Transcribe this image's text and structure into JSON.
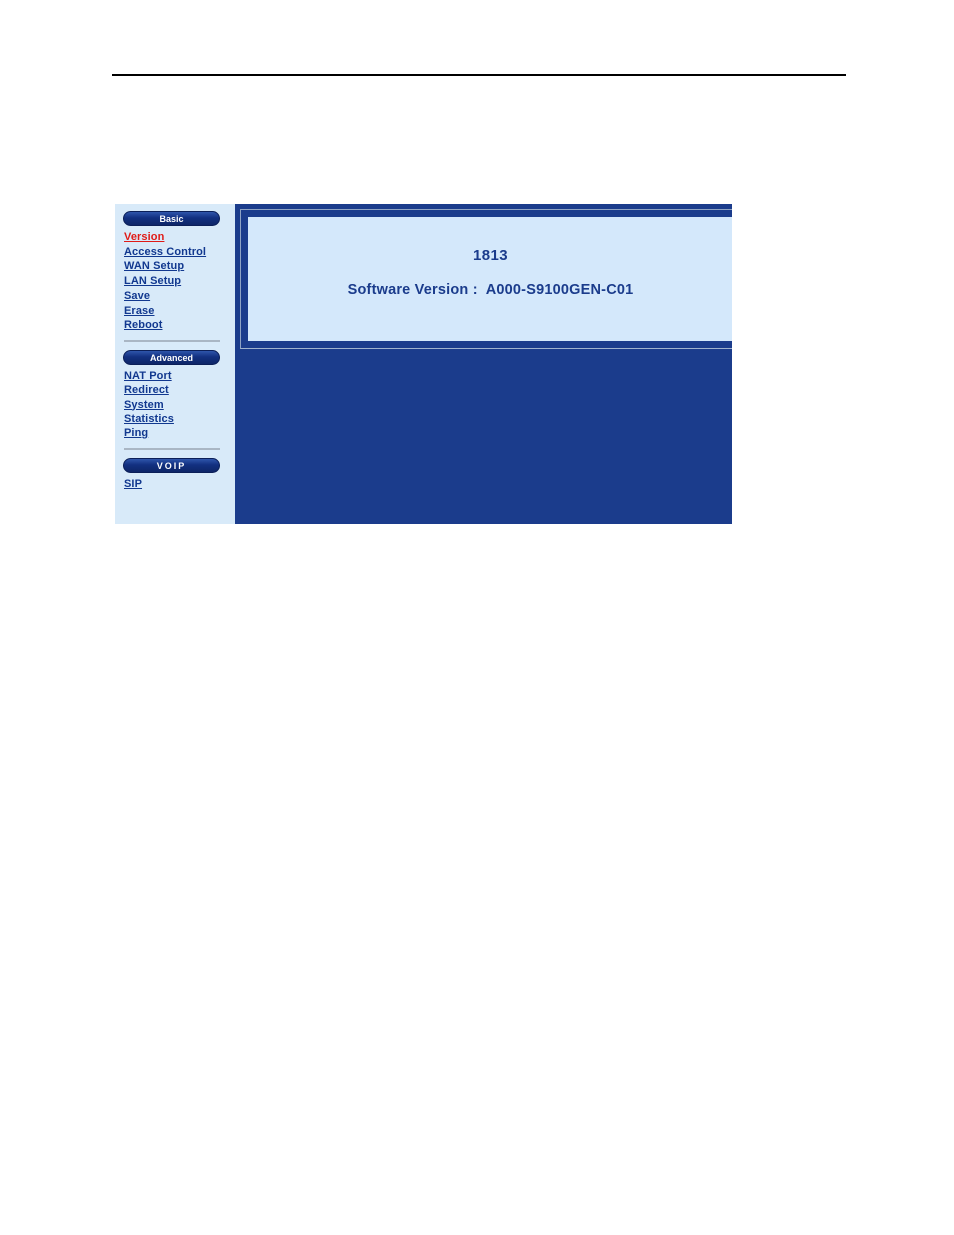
{
  "page": {
    "header_rule": "horizontal-rule",
    "background_color": "#ffffff"
  },
  "router_ui": {
    "sidebar": {
      "background_color": "#d8eaf9",
      "sections": [
        {
          "button_label": "Basic",
          "items": [
            {
              "label": "Version",
              "state": "active",
              "color": "#e01b17"
            },
            {
              "label": "Access Control",
              "state": "normal",
              "color": "#11388f"
            },
            {
              "label": "WAN Setup",
              "state": "normal",
              "color": "#11388f"
            },
            {
              "label": "LAN Setup",
              "state": "normal",
              "color": "#11388f"
            },
            {
              "label": "Save",
              "state": "normal",
              "color": "#11388f"
            },
            {
              "label": "Erase",
              "state": "normal",
              "color": "#11388f"
            },
            {
              "label": "Reboot",
              "state": "normal",
              "color": "#11388f"
            }
          ]
        },
        {
          "button_label": "Advanced",
          "items": [
            {
              "label": "NAT Port Redirect",
              "state": "normal",
              "color": "#11388f"
            },
            {
              "label": "System Statistics",
              "state": "normal",
              "color": "#11388f"
            },
            {
              "label": "Ping",
              "state": "normal",
              "color": "#11388f"
            }
          ]
        },
        {
          "button_label": "VOIP",
          "items": [
            {
              "label": "SIP",
              "state": "normal",
              "color": "#11388f"
            }
          ]
        }
      ]
    },
    "main_panel": {
      "background_color": "#1b3c8c",
      "content_box": {
        "background_color": "#d4e8fb",
        "device_number": "1813",
        "software_version_label": "Software Version :",
        "software_version_value": "A000-S9100GEN-C01"
      }
    }
  }
}
